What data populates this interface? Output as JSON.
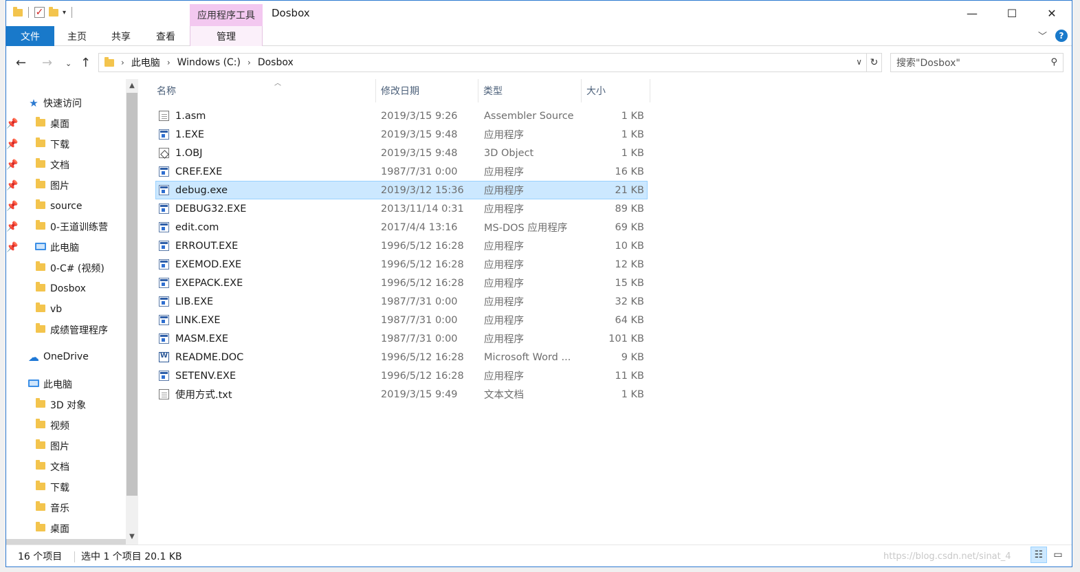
{
  "titlebar": {
    "context_tab_header": "应用程序工具",
    "title": "Dosbox",
    "minimize": "—",
    "maximize": "☐",
    "close": "✕"
  },
  "ribbon": {
    "tabs": [
      "文件",
      "主页",
      "共享",
      "查看",
      "管理"
    ],
    "expand": "﹀",
    "help": "?"
  },
  "address": {
    "crumbs": [
      "此电脑",
      "Windows (C:)",
      "Dosbox"
    ],
    "search_placeholder": "搜索\"Dosbox\""
  },
  "nav": {
    "quick_access": "快速访问",
    "quick_items": [
      "桌面",
      "下载",
      "文档",
      "图片",
      "source",
      "0-王道训练营",
      "此电脑",
      "0-C# (视频)",
      "Dosbox",
      "vb",
      "成绩管理程序"
    ],
    "onedrive": "OneDrive",
    "this_pc": "此电脑",
    "pc_items": [
      "3D 对象",
      "视频",
      "图片",
      "文档",
      "下载",
      "音乐",
      "桌面"
    ]
  },
  "columns": {
    "name": "名称",
    "date": "修改日期",
    "type": "类型",
    "size": "大小"
  },
  "files": [
    {
      "name": "1.asm",
      "date": "2019/3/15 9:26",
      "type": "Assembler Source",
      "size": "1 KB",
      "icon": "txt-icon"
    },
    {
      "name": "1.EXE",
      "date": "2019/3/15 9:48",
      "type": "应用程序",
      "size": "1 KB",
      "icon": "exe-icon"
    },
    {
      "name": "1.OBJ",
      "date": "2019/3/15 9:48",
      "type": "3D Object",
      "size": "1 KB",
      "icon": "obj-icon"
    },
    {
      "name": "CREF.EXE",
      "date": "1987/7/31 0:00",
      "type": "应用程序",
      "size": "16 KB",
      "icon": "exe-icon"
    },
    {
      "name": "debug.exe",
      "date": "2019/3/12 15:36",
      "type": "应用程序",
      "size": "21 KB",
      "icon": "exe-icon",
      "selected": true
    },
    {
      "name": "DEBUG32.EXE",
      "date": "2013/11/14 0:31",
      "type": "应用程序",
      "size": "89 KB",
      "icon": "exe-icon"
    },
    {
      "name": "edit.com",
      "date": "2017/4/4 13:16",
      "type": "MS-DOS 应用程序",
      "size": "69 KB",
      "icon": "exe-icon"
    },
    {
      "name": "ERROUT.EXE",
      "date": "1996/5/12 16:28",
      "type": "应用程序",
      "size": "10 KB",
      "icon": "exe-icon"
    },
    {
      "name": "EXEMOD.EXE",
      "date": "1996/5/12 16:28",
      "type": "应用程序",
      "size": "12 KB",
      "icon": "exe-icon"
    },
    {
      "name": "EXEPACK.EXE",
      "date": "1996/5/12 16:28",
      "type": "应用程序",
      "size": "15 KB",
      "icon": "exe-icon"
    },
    {
      "name": "LIB.EXE",
      "date": "1987/7/31 0:00",
      "type": "应用程序",
      "size": "32 KB",
      "icon": "exe-icon"
    },
    {
      "name": "LINK.EXE",
      "date": "1987/7/31 0:00",
      "type": "应用程序",
      "size": "64 KB",
      "icon": "exe-icon"
    },
    {
      "name": "MASM.EXE",
      "date": "1987/7/31 0:00",
      "type": "应用程序",
      "size": "101 KB",
      "icon": "exe-icon"
    },
    {
      "name": "README.DOC",
      "date": "1996/5/12 16:28",
      "type": "Microsoft Word ...",
      "size": "9 KB",
      "icon": "word-doc-icon"
    },
    {
      "name": "SETENV.EXE",
      "date": "1996/5/12 16:28",
      "type": "应用程序",
      "size": "11 KB",
      "icon": "exe-icon"
    },
    {
      "name": "使用方式.txt",
      "date": "2019/3/15 9:49",
      "type": "文本文档",
      "size": "1 KB",
      "icon": "txt-icon"
    }
  ],
  "status": {
    "count": "16 个项目",
    "selection": "选中 1 个项目  20.1 KB",
    "watermark": "https://blog.csdn.net/sinat_4"
  },
  "colors": {
    "accent": "#1979ca",
    "selection": "#cce8ff",
    "selection_border": "#99d1ff",
    "context_tab": "#f3c8f0"
  }
}
